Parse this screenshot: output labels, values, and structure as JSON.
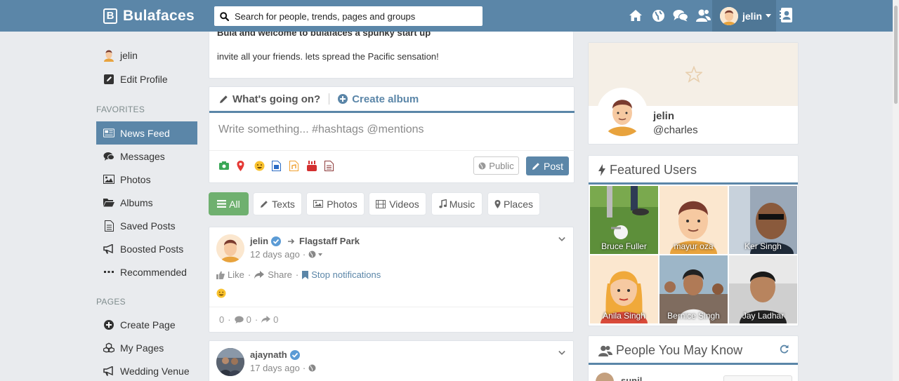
{
  "app": {
    "logo_letter": "B",
    "logo_text": "Bulafaces"
  },
  "search": {
    "placeholder": "Search for people, trends, pages and groups"
  },
  "topbar": {
    "username": "jelin"
  },
  "sidebar": {
    "user_label": "jelin",
    "edit_profile": "Edit Profile",
    "favorites_heading": "FAVORITES",
    "items": [
      {
        "label": "News Feed",
        "icon": "newspaper-icon"
      },
      {
        "label": "Messages",
        "icon": "chat-icon"
      },
      {
        "label": "Photos",
        "icon": "photo-icon"
      },
      {
        "label": "Albums",
        "icon": "folder-icon"
      },
      {
        "label": "Saved Posts",
        "icon": "document-icon"
      },
      {
        "label": "Boosted Posts",
        "icon": "bullhorn-icon"
      },
      {
        "label": "Recommended",
        "icon": "ellipsis-icon"
      }
    ],
    "pages_heading": "PAGES",
    "pages": [
      {
        "label": "Create Page",
        "icon": "plus-circle-icon"
      },
      {
        "label": "My Pages",
        "icon": "cubes-icon"
      },
      {
        "label": "Wedding Venue",
        "icon": "bullhorn-icon"
      }
    ]
  },
  "welcome": {
    "title": "Bula and welcome to bulafaces a spunky start up",
    "text": "invite all your friends. lets spread the Pacific sensation!"
  },
  "composer": {
    "tab_status": "What's going on?",
    "tab_album": "Create album",
    "placeholder": "Write something... #hashtags @mentions",
    "public_label": "Public",
    "post_label": "Post"
  },
  "filters": [
    "All",
    "Texts",
    "Photos",
    "Videos",
    "Music",
    "Places"
  ],
  "posts": [
    {
      "author": "jelin",
      "place": "Flagstaff Park",
      "time": "12 days ago",
      "like": "Like",
      "share": "Share",
      "stop": "Stop notifications",
      "likes_count": "0",
      "comments_count": "0",
      "shares_count": "0"
    },
    {
      "author": "ajaynath",
      "time": "17 days ago"
    }
  ],
  "profile": {
    "name": "jelin",
    "handle": "@charles"
  },
  "featured": {
    "title": "Featured Users",
    "users": [
      "Bruce Fuller",
      "mayur oza",
      "Ker Singh",
      "Anila Singh",
      "Bernice Singh",
      "Jay Ladhar"
    ]
  },
  "people": {
    "title": "People You May Know",
    "first": "sunil"
  },
  "colors": {
    "brand": "#5b86a8",
    "active_filter": "#6fb06f",
    "background": "#e9ebee"
  }
}
